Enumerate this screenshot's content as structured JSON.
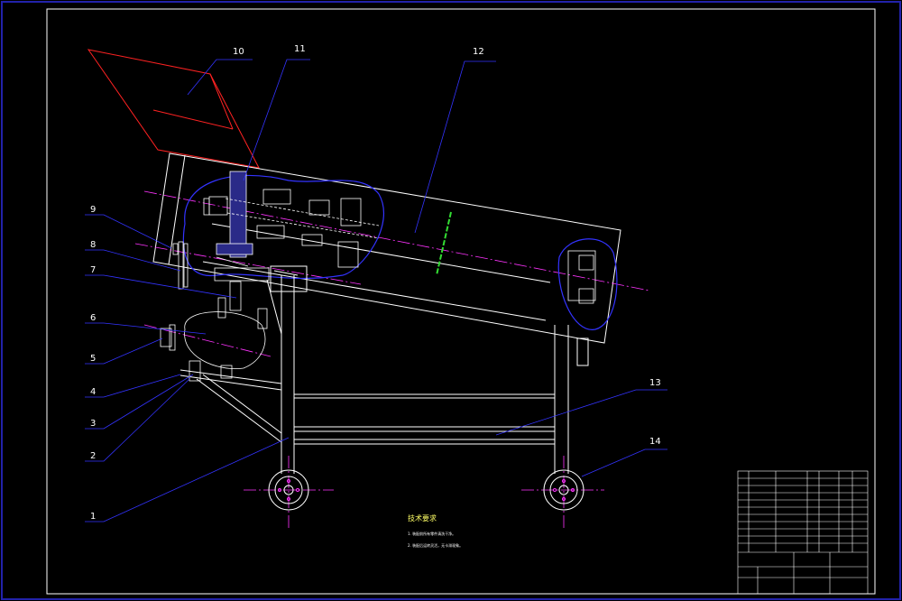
{
  "colors": {
    "background": "#000000",
    "frame": "#ffffff",
    "leader": "#3333ff",
    "hopper": "#ff2222",
    "centerline": "#ff33ff",
    "gear_fill": "#2a2a88",
    "highlight": "#33dd33",
    "title_block": "#ffffff",
    "notes_title": "#ffff66"
  },
  "part_labels": [
    {
      "id": "1",
      "text": "1"
    },
    {
      "id": "2",
      "text": "2"
    },
    {
      "id": "3",
      "text": "3"
    },
    {
      "id": "4",
      "text": "4"
    },
    {
      "id": "5",
      "text": "5"
    },
    {
      "id": "6",
      "text": "6"
    },
    {
      "id": "7",
      "text": "7"
    },
    {
      "id": "8",
      "text": "8"
    },
    {
      "id": "9",
      "text": "9"
    },
    {
      "id": "10",
      "text": "10"
    },
    {
      "id": "11",
      "text": "11"
    },
    {
      "id": "12",
      "text": "12"
    },
    {
      "id": "13",
      "text": "13"
    },
    {
      "id": "14",
      "text": "14"
    }
  ],
  "notes": {
    "title": "技术要求",
    "lines": [
      "1. 装配前所有零件清洗干净。",
      "2. 装配后运转灵活，无卡滞现象。"
    ]
  }
}
